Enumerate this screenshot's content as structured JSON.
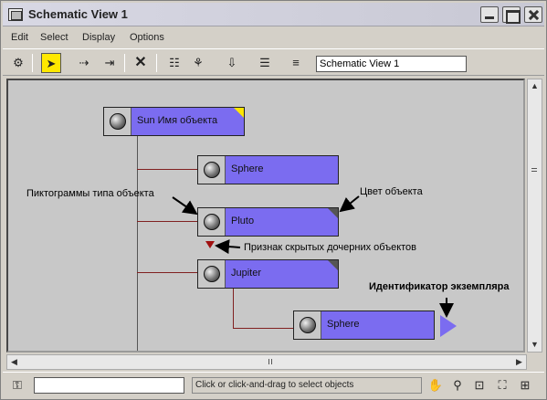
{
  "window": {
    "title": "Schematic View 1"
  },
  "menu": [
    "Edit",
    "Select",
    "Display",
    "Options"
  ],
  "toolbar": {
    "view_name": "Schematic View 1",
    "icons": [
      "filter-icon",
      "select-arrow-icon",
      "link-icon",
      "unlink-icon",
      "delete-icon",
      "hierarchy-icon",
      "references-icon",
      "collapse-icon",
      "list-icon",
      "list-view-icon"
    ]
  },
  "nodes": [
    {
      "name": "Sun",
      "label": "Sun  Имя объекта",
      "corner": "#ffe600"
    },
    {
      "name": "Sphere",
      "label": "Sphere",
      "corner": ""
    },
    {
      "name": "Pluto",
      "label": "Pluto",
      "corner": "#555555"
    },
    {
      "name": "Jupiter",
      "label": "Jupiter",
      "corner": "#555555"
    },
    {
      "name": "Sphere-instance",
      "label": "Sphere",
      "corner": ""
    }
  ],
  "annotations": {
    "type_icon": "Пиктограммы типа объекта",
    "object_color": "Цвет объекта",
    "hidden_children": "Признак скрытых дочерних объектов",
    "instance_id": "Идентификатор экземпляра"
  },
  "colors": {
    "node_fill": "#7b6cf0",
    "canvas": "#c8c8c8",
    "hidden_marker": "#a01010"
  },
  "status": {
    "prompt": "Click or click-and-drag to select objects",
    "icons": [
      "pan-hand-icon",
      "zoom-icon",
      "zoom-region-icon",
      "zoom-extents-icon",
      "zoom-selected-icon"
    ]
  }
}
